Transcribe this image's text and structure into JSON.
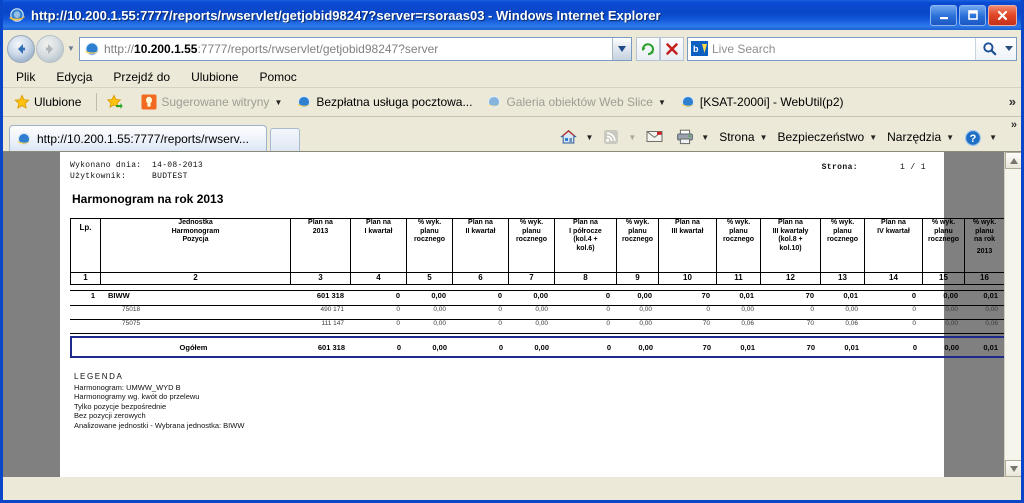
{
  "window": {
    "title": "http://10.200.1.55:7777/reports/rwservlet/getjobid98247?server=rsoraas03 - Windows Internet Explorer",
    "minimize_label": "_",
    "maximize_label": "□",
    "close_label": "✕"
  },
  "navbar": {
    "address_prefix": "http://",
    "address_host": "10.200.1.55",
    "address_rest": ":7777/reports/rwservlet/getjobid98247?server",
    "address_full": "http://10.200.1.55:7777/reports/rwservlet/getjobid98247?server",
    "refresh_title": "Odśwież",
    "stop_title": "Zatrzymaj",
    "search_placeholder": "Live Search",
    "dropdown_glyph": "▼",
    "go_glyph": "🔍"
  },
  "menu": {
    "items": [
      {
        "label": "Plik"
      },
      {
        "label": "Edycja"
      },
      {
        "label": "Przejdź do"
      },
      {
        "label": "Ulubione"
      },
      {
        "label": "Pomoc"
      }
    ]
  },
  "favorites": {
    "favorites_label": "Ulubione",
    "items": [
      {
        "label": "Sugerowane witryny",
        "dim": true,
        "caret": true
      },
      {
        "label": "Bezpłatna usługa pocztowa...",
        "dim": false,
        "caret": false
      },
      {
        "label": "Galeria obiektów Web Slice",
        "dim": true,
        "caret": true
      },
      {
        "label": "[KSAT-2000i] - WebUtil(p2)",
        "dim": false,
        "caret": false
      }
    ],
    "overflow_glyph": "»"
  },
  "tabs": {
    "items": [
      {
        "label": "http://10.200.1.55:7777/reports/rwserv..."
      }
    ],
    "new_tab_title": "Nowa karta"
  },
  "command_bar": {
    "home_label": "Strona główna",
    "feeds_label": "Kanały informacyjne",
    "mail_label": "Poczta",
    "print_label": "Drukuj",
    "items": [
      {
        "label": "Strona",
        "caret": true
      },
      {
        "label": "Bezpieczeństwo",
        "caret": true
      },
      {
        "label": "Narzędzia",
        "caret": true
      }
    ],
    "help_label": "?",
    "overflow_glyph": "»"
  },
  "report": {
    "executed_label": "Wykonano dnia:",
    "executed_value": "14-08-2013",
    "user_label": "Użytkownik:",
    "user_value": "BUDTEST",
    "page_label": "Strona:",
    "page_value": "1 / 1",
    "title": "Harmonogram na rok 2013",
    "columns": [
      {
        "num": "1",
        "lines": [
          "Lp."
        ]
      },
      {
        "num": "2",
        "lines": [
          "Jednostka",
          "Harmonogram",
          "Pozycja"
        ]
      },
      {
        "num": "3",
        "lines": [
          "Plan na",
          "2013"
        ]
      },
      {
        "num": "4",
        "lines": [
          "Plan na",
          "I kwartał"
        ]
      },
      {
        "num": "5",
        "lines": [
          "% wyk.",
          "planu",
          "rocznego"
        ]
      },
      {
        "num": "6",
        "lines": [
          "Plan na",
          "II kwartał"
        ]
      },
      {
        "num": "7",
        "lines": [
          "% wyk.",
          "planu",
          "rocznego"
        ]
      },
      {
        "num": "8",
        "lines": [
          "Plan na",
          "I półrocze",
          "(kol.4 +",
          "kol.6)"
        ]
      },
      {
        "num": "9",
        "lines": [
          "% wyk.",
          "planu",
          "rocznego"
        ]
      },
      {
        "num": "10",
        "lines": [
          "Plan na",
          "III kwartał"
        ]
      },
      {
        "num": "11",
        "lines": [
          "% wyk.",
          "planu",
          "rocznego"
        ]
      },
      {
        "num": "12",
        "lines": [
          "Plan na",
          "III kwartały",
          "(kol.8 +",
          "kol.10)"
        ]
      },
      {
        "num": "13",
        "lines": [
          "% wyk.",
          "planu",
          "rocznego"
        ]
      },
      {
        "num": "14",
        "lines": [
          "Plan na",
          "IV kwartał"
        ]
      },
      {
        "num": "15",
        "lines": [
          "% wyk.",
          "planu",
          "rocznego"
        ]
      },
      {
        "num": "16",
        "lines": [
          "% wyk.",
          "planu",
          "na rok",
          "2013"
        ]
      }
    ],
    "rows": [
      {
        "lp": "1",
        "name": "BIWW",
        "sub": false,
        "cells": [
          "601 318",
          "0",
          "0,00",
          "0",
          "0,00",
          "0",
          "0,00",
          "70",
          "0,01",
          "70",
          "0,01",
          "0",
          "0,00",
          "0,01"
        ]
      },
      {
        "lp": "",
        "name": "75018",
        "sub": true,
        "cells": [
          "490 171",
          "0",
          "0,00",
          "0",
          "0,00",
          "0",
          "0,00",
          "0",
          "0,00",
          "0",
          "0,00",
          "0",
          "0,00",
          "0,00"
        ]
      },
      {
        "lp": "",
        "name": "75075",
        "sub": true,
        "cells": [
          "111 147",
          "0",
          "0,00",
          "0",
          "0,00",
          "0",
          "0,00",
          "70",
          "0,06",
          "70",
          "0,06",
          "0",
          "0,00",
          "0,06"
        ]
      }
    ],
    "total": {
      "label": "Ogółem",
      "cells": [
        "601 318",
        "0",
        "0,00",
        "0",
        "0,00",
        "0",
        "0,00",
        "70",
        "0,01",
        "70",
        "0,01",
        "0",
        "0,00",
        "0,01"
      ]
    },
    "legend": {
      "title": "LEGENDA",
      "lines": [
        "Harmonogram: UMWW_WYD B",
        "Harmonogramy wg. kwót do przelewu",
        "Tylko pozycje bezpośrednie",
        "Bez pozycji zerowych",
        "Analizowane jednostki -  Wybrana jednostka: BIWW"
      ]
    }
  },
  "scrollbar": {
    "up_glyph": "▲",
    "down_glyph": "▼"
  }
}
